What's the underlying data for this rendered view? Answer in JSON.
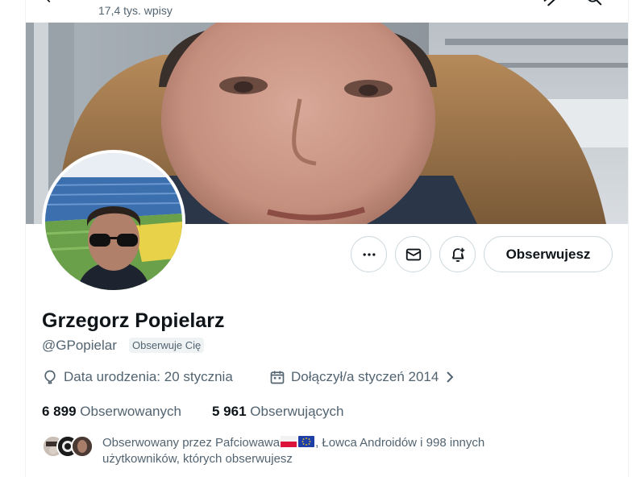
{
  "header": {
    "post_count": "17,4 tys. wpisy"
  },
  "profile": {
    "name": "Grzegorz Popielarz",
    "handle": "@GPopielar",
    "follows_you_badge": "Obserwuje Cię",
    "birthday": "Data urodzenia: 20 stycznia",
    "joined": "Dołączył/a styczeń 2014",
    "following_count": "6 899",
    "following_label": "Obserwowanych",
    "followers_count": "5 961",
    "followers_label": "Obserwujących"
  },
  "actions": {
    "follow_button": "Obserwujesz",
    "more_icon": "more-horizontal-icon",
    "message_icon": "mail-icon",
    "notify_icon": "bell-plus-icon"
  },
  "followers_you_know": {
    "prefix": "Obserwowany przez Pafciowawa",
    "middle": ", Łowca Androidów i 998 innych",
    "suffix": "użytkowników, których obserwujesz",
    "flags": [
      "flag-poland-icon",
      "flag-eu-icon"
    ]
  },
  "colors": {
    "text_primary": "#0f1419",
    "text_secondary": "#536471",
    "border": "#cfd9de",
    "badge_bg": "#eff3f4"
  }
}
